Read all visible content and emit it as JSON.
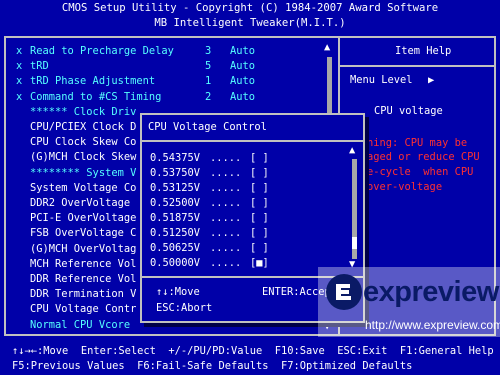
{
  "header": {
    "line1": "CMOS Setup Utility - Copyright (C) 1984-2007 Award Software",
    "line2": "MB Intelligent Tweaker(M.I.T.)"
  },
  "menu": {
    "items": [
      {
        "mark": "x",
        "label": "Read to Precharge Delay",
        "value": "3",
        "mode": "Auto"
      },
      {
        "mark": "x",
        "label": "tRD",
        "value": "5",
        "mode": "Auto"
      },
      {
        "mark": "x",
        "label": "tRD Phase Adjustment",
        "value": "1",
        "mode": "Auto"
      },
      {
        "mark": "x",
        "label": "Command to #CS Timing",
        "value": "2",
        "mode": "Auto"
      },
      {
        "mark": "",
        "label": "****** Clock Driv",
        "value": "",
        "mode": ""
      },
      {
        "mark": "",
        "label": "CPU/PCIEX Clock D",
        "value": "",
        "mode": ""
      },
      {
        "mark": "",
        "label": "CPU Clock Skew Co",
        "value": "",
        "mode": ""
      },
      {
        "mark": "",
        "label": "(G)MCH Clock Skew",
        "value": "",
        "mode": ""
      },
      {
        "mark": "",
        "label": "******** System V",
        "value": "",
        "mode": ""
      },
      {
        "mark": "",
        "label": "System Voltage Co",
        "value": "",
        "mode": ""
      },
      {
        "mark": "",
        "label": "DDR2 OverVoltage",
        "value": "",
        "mode": ""
      },
      {
        "mark": "",
        "label": "PCI-E OverVoltage",
        "value": "",
        "mode": ""
      },
      {
        "mark": "",
        "label": "FSB OverVoltage C",
        "value": "",
        "mode": ""
      },
      {
        "mark": "",
        "label": "(G)MCH OverVoltag",
        "value": "",
        "mode": ""
      },
      {
        "mark": "",
        "label": "MCH Reference Vol",
        "value": "",
        "mode": ""
      },
      {
        "mark": "",
        "label": "DDR Reference Vol",
        "value": "",
        "mode": ""
      },
      {
        "mark": "",
        "label": "DDR Termination V",
        "value": "",
        "mode": ""
      },
      {
        "mark": "",
        "label": "CPU Voltage Contr",
        "value": "",
        "mode": ""
      },
      {
        "mark": "",
        "label": "Normal CPU Vcore",
        "value": "",
        "mode": ""
      }
    ]
  },
  "help": {
    "title": "Item Help",
    "menu_level": "Menu Level",
    "menu_level_arrow": "▶",
    "topic": "CPU voltage",
    "warning_lines": [
      "ning: CPU may be",
      "aged or reduce CPU",
      "e-cycle  when CPU",
      "over-voltage"
    ]
  },
  "dialog": {
    "title": "CPU Voltage Control",
    "options": [
      {
        "value": "0.54375V",
        "dots": ".....",
        "box": "[ ]"
      },
      {
        "value": "0.53750V",
        "dots": ".....",
        "box": "[ ]"
      },
      {
        "value": "0.53125V",
        "dots": ".....",
        "box": "[ ]"
      },
      {
        "value": "0.52500V",
        "dots": ".....",
        "box": "[ ]"
      },
      {
        "value": "0.51875V",
        "dots": ".....",
        "box": "[ ]"
      },
      {
        "value": "0.51250V",
        "dots": ".....",
        "box": "[ ]"
      },
      {
        "value": "0.50625V",
        "dots": ".....",
        "box": "[ ]"
      },
      {
        "value": "0.50000V",
        "dots": ".....",
        "box": "[■]"
      }
    ],
    "hint_move": "↑↓:Move",
    "hint_enter": "ENTER:Accep",
    "hint_esc": "ESC:Abort"
  },
  "footer": {
    "line1": "↑↓→←:Move  Enter:Select  +/-/PU/PD:Value  F10:Save  ESC:Exit  F1:General Help",
    "line2": "F5:Previous Values  F6:Fail-Safe Defaults  F7:Optimized Defaults"
  },
  "watermark": {
    "brand": "expreview",
    "url": "http://www.expreview.com"
  },
  "colors": {
    "background": "#0000a8",
    "accent_cyan": "#56ffff",
    "warning_red": "#ff3030",
    "text_white": "#ffffff"
  },
  "icons": [
    "scroll-up-arrow-icon",
    "scroll-down-arrow-icon",
    "menu-level-arrow-icon",
    "expreview-logo-icon"
  ]
}
